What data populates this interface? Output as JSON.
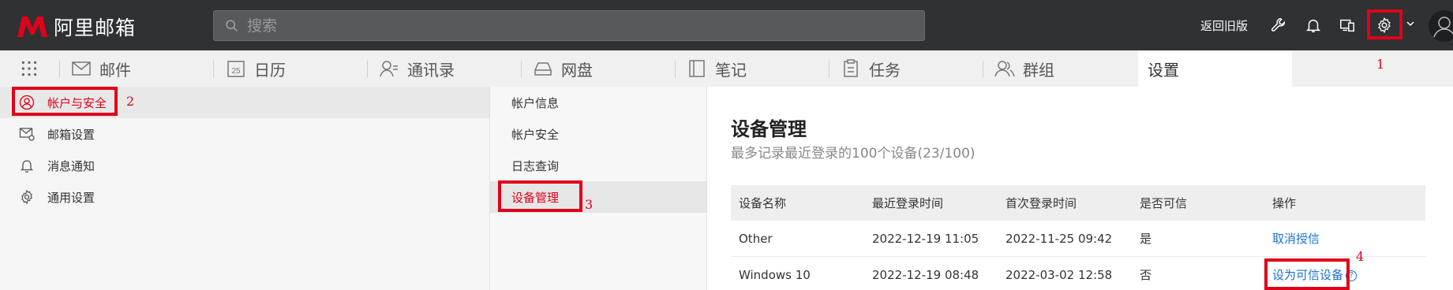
{
  "app": {
    "logo_text": "阿里邮箱",
    "brand_color": "#e0001a"
  },
  "topbar": {
    "search_placeholder": "搜索",
    "old_version_link": "返回旧版",
    "icons": [
      "wrench-icon",
      "bell-icon",
      "device-switch-icon",
      "gear-icon",
      "chevron-down-icon",
      "avatar"
    ]
  },
  "nav": {
    "apps_icon": "grid-icon",
    "tabs": [
      {
        "label": "邮件",
        "icon": "mail-icon"
      },
      {
        "label": "日历",
        "icon": "calendar-icon",
        "icon_text": "25"
      },
      {
        "label": "通讯录",
        "icon": "contacts-icon"
      },
      {
        "label": "网盘",
        "icon": "drive-icon"
      },
      {
        "label": "笔记",
        "icon": "notes-icon"
      },
      {
        "label": "任务",
        "icon": "tasks-icon"
      },
      {
        "label": "群组",
        "icon": "group-icon"
      },
      {
        "label": "设置",
        "icon": "",
        "active": true
      }
    ]
  },
  "sidebar": {
    "items": [
      {
        "label": "帐户与安全",
        "icon": "user-circle-icon",
        "active": true
      },
      {
        "label": "邮箱设置",
        "icon": "mail-gear-icon"
      },
      {
        "label": "消息通知",
        "icon": "bell-icon"
      },
      {
        "label": "通用设置",
        "icon": "gear-icon"
      }
    ]
  },
  "subnav": {
    "items": [
      {
        "label": "帐户信息"
      },
      {
        "label": "帐户安全"
      },
      {
        "label": "日志查询"
      },
      {
        "label": "设备管理",
        "active": true
      }
    ]
  },
  "main": {
    "title": "设备管理",
    "subtitle": "最多记录最近登录的100个设备(23/100)",
    "table": {
      "headers": [
        "设备名称",
        "最近登录时间",
        "首次登录时间",
        "是否可信",
        "操作"
      ],
      "rows": [
        {
          "device": "Other",
          "last_login": "2022-12-19 11:05",
          "first_login": "2022-11-25 09:42",
          "trusted": "是",
          "action": "取消授信"
        },
        {
          "device": "Windows 10",
          "last_login": "2022-12-19 08:48",
          "first_login": "2022-03-02 12:58",
          "trusted": "否",
          "action": "设为可信设备",
          "help_mark": "?"
        }
      ]
    }
  },
  "annotations": [
    "1",
    "2",
    "3",
    "4"
  ]
}
